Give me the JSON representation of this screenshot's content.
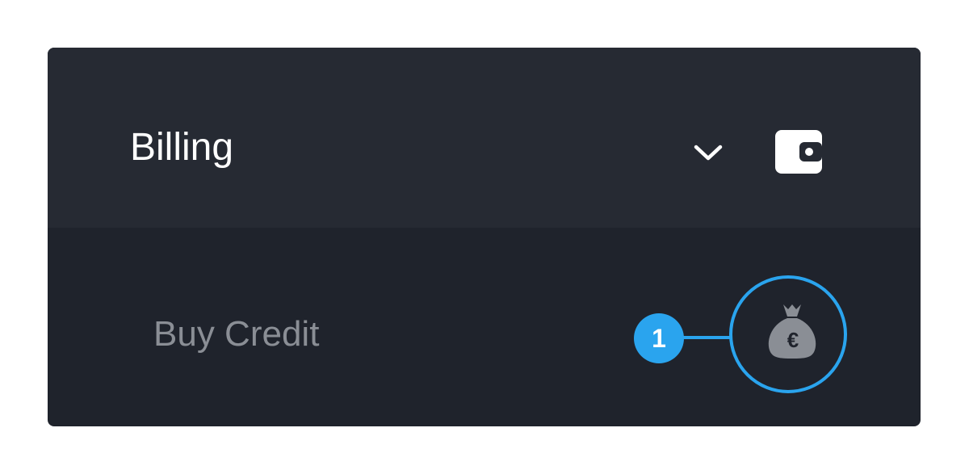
{
  "menu": {
    "title": "Billing",
    "toggle_icon": "chevron-down-icon",
    "section_icon": "wallet-icon",
    "items": [
      {
        "label": "Buy Credit",
        "icon": "money-bag-euro-icon"
      }
    ]
  },
  "callout": {
    "number": "1",
    "color": "#2aa4ee"
  },
  "colors": {
    "header_bg": "#262a33",
    "body_bg": "#1f232c",
    "item_text": "#8a8e95",
    "icon_fill": "#8a8e95"
  }
}
